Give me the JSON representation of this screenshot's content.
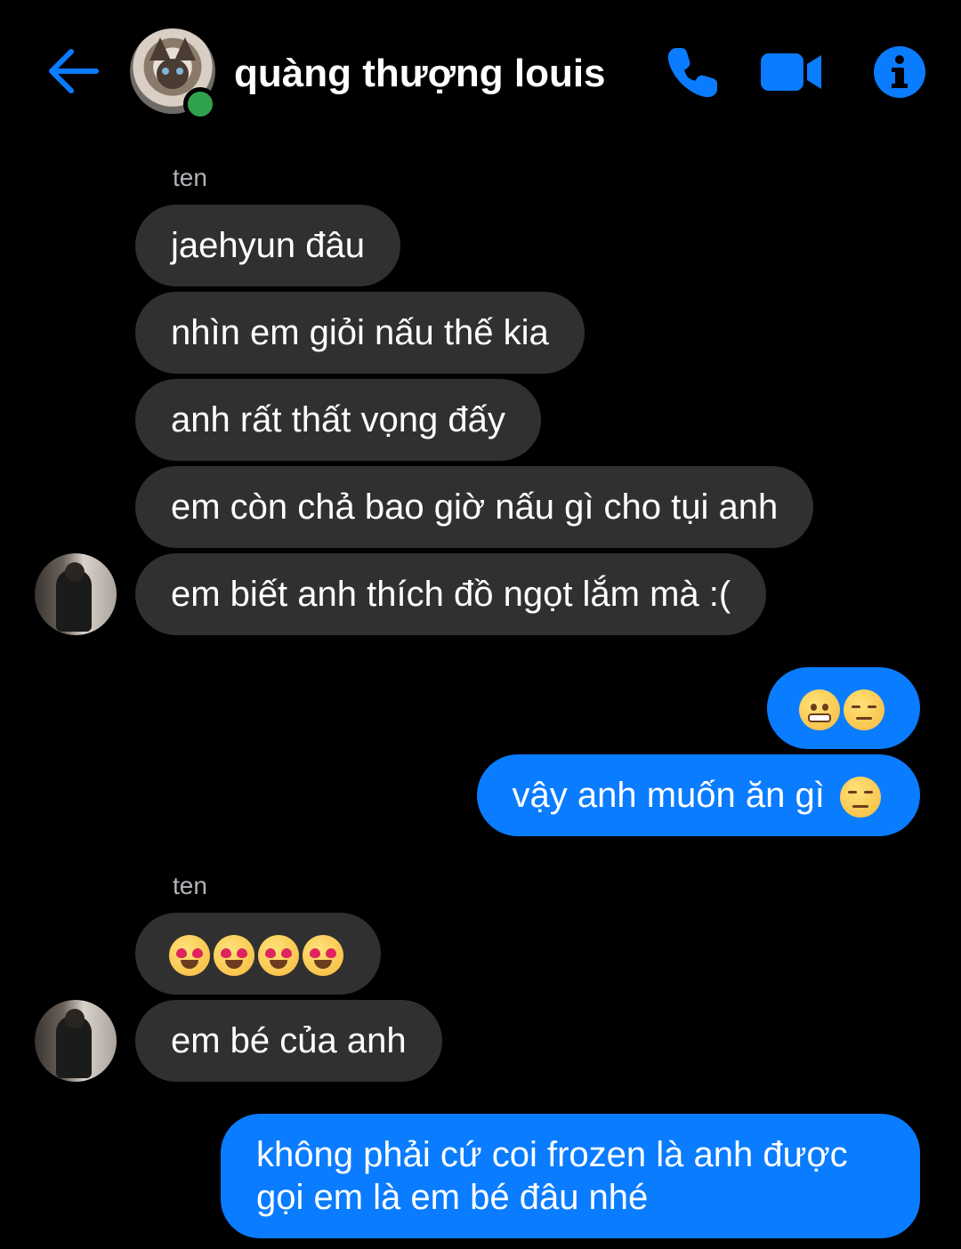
{
  "header": {
    "contact_name": "quàng thượng louis",
    "online": true,
    "accent_color": "#0a7cff",
    "icons": [
      "back-arrow-icon",
      "phone-icon",
      "video-camera-icon",
      "info-icon"
    ]
  },
  "messages": [
    {
      "sender_label": "ten"
    },
    {
      "text": "jaehyun đâu"
    },
    {
      "text": "nhìn em giỏi nấu thế kia"
    },
    {
      "text": "anh rất thất vọng đấy"
    },
    {
      "text": "em còn chả bao giờ nấu gì cho tụi anh"
    },
    {
      "text": "em biết anh thích đồ ngọt lắm mà :("
    },
    {
      "emojis": [
        "grimacing-face",
        "pensive-face"
      ]
    },
    {
      "text": "vậy anh muốn ăn gì",
      "emoji": "unamused-face"
    },
    {
      "sender_label": "ten"
    },
    {
      "emojis": [
        "heart-eyes-face",
        "heart-eyes-face",
        "heart-eyes-face",
        "heart-eyes-face"
      ]
    },
    {
      "text": "em bé của anh"
    },
    {
      "lines": [
        "không phải cứ coi frozen là anh được",
        "gọi em là em bé đâu nhé"
      ]
    }
  ]
}
